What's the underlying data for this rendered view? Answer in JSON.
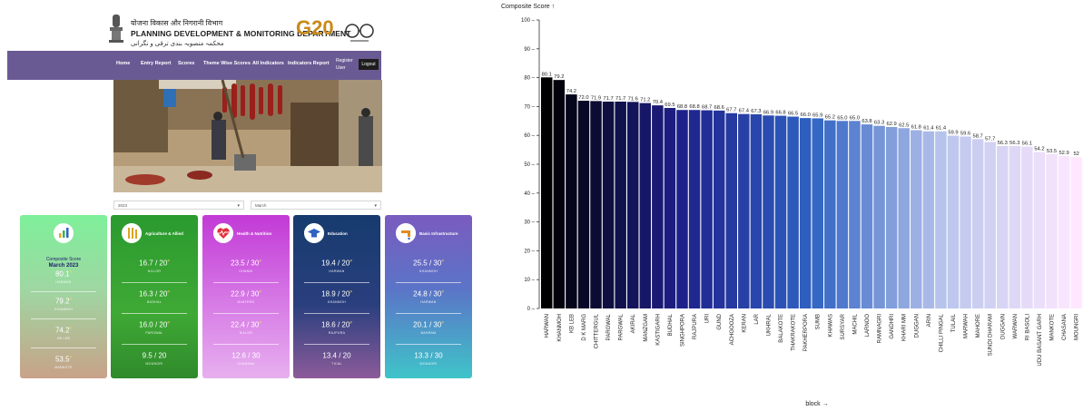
{
  "site": {
    "header": {
      "hindi_title": "योजना विकास और निगरानी विभाग",
      "title": "PLANNING DEVELOPMENT & MONITORING DEPARTMENT",
      "urdu_title": "محکمہ منصوبہ بندی ترقی و نگرانی",
      "g20_logo": "G20"
    },
    "nav": {
      "items": [
        "Home",
        "Entry Report",
        "Scores",
        "Theme Wise Scores",
        "All Indicators",
        "Indicators Report"
      ],
      "register": "Register User",
      "logout": "Logout"
    },
    "filters": {
      "year": "2023",
      "month": "March"
    },
    "cards": [
      {
        "name": "Composite Score",
        "subtitle": "March 2023",
        "icon": "bar-chart-icon",
        "rows": [
          {
            "value": "80.1",
            "sup": "#",
            "label": "HARWAN"
          },
          {
            "value": "79.2",
            "sup": "#",
            "label": "KHANMOH"
          },
          {
            "value": "74.2",
            "sup": "#",
            "label": "KB LEB"
          },
          {
            "value": "53.5",
            "sup": "#",
            "label": "MANKOTE"
          }
        ]
      },
      {
        "name": "Agriculture & Allied",
        "icon": "wheat-icon",
        "rows": [
          {
            "value": "16.7 / 20",
            "sup": "#",
            "label": "NILLOR"
          },
          {
            "value": "16.3 / 20",
            "sup": "#",
            "label": "BUDHAL"
          },
          {
            "value": "16.0 / 20",
            "sup": "#",
            "label": "PARGWAL"
          },
          {
            "value": "9.5 / 20",
            "sup": "",
            "label": "MOUNGRI"
          }
        ]
      },
      {
        "name": "Health & Nutrition",
        "icon": "heart-pulse-icon",
        "rows": [
          {
            "value": "23.5 / 30",
            "sup": "#",
            "label": "CHANDI"
          },
          {
            "value": "22.9 / 30",
            "sup": "#",
            "label": "DHATERO"
          },
          {
            "value": "22.4 / 30",
            "sup": "#",
            "label": "NILLOR"
          },
          {
            "value": "12.6 / 30",
            "sup": "",
            "label": "CHASANA"
          }
        ]
      },
      {
        "name": "Education",
        "icon": "graduation-cap-icon",
        "rows": [
          {
            "value": "19.4 / 20",
            "sup": "#",
            "label": "HARWAN"
          },
          {
            "value": "18.9 / 20",
            "sup": "#",
            "label": "KHANMOH"
          },
          {
            "value": "18.6 / 20",
            "sup": "#",
            "label": "RAJPURA"
          },
          {
            "value": "13.4 / 20",
            "sup": "",
            "label": "TICAL"
          }
        ]
      },
      {
        "name": "Basic Infrastructure",
        "icon": "tap-icon",
        "rows": [
          {
            "value": "25.5 / 30",
            "sup": "#",
            "label": "KHANMOH"
          },
          {
            "value": "24.8 / 30",
            "sup": "#",
            "label": "HARWAN"
          },
          {
            "value": "20.1 / 30",
            "sup": "#",
            "label": "BAHRAM"
          },
          {
            "value": "13.3 / 30",
            "sup": "",
            "label": "MOUNGRI"
          }
        ]
      }
    ]
  },
  "chart_data": {
    "type": "bar",
    "ylabel": "Composite Score ↑",
    "xlabel": "block →",
    "ylim": [
      0,
      100
    ],
    "yticks": [
      0,
      10,
      20,
      30,
      40,
      50,
      60,
      70,
      80,
      90,
      100
    ],
    "grid": false,
    "color_ramp": [
      "#000000",
      "#1f1f8a",
      "#2f62c2",
      "#b9c5ec",
      "#ffe8ff"
    ],
    "categories": [
      "HARWAN",
      "KHANMOH",
      "KB LEB",
      "D K MARG",
      "CHITTERGUL",
      "PARGWAL",
      "PARGWAL",
      "AKIRAL",
      "MANZGAM",
      "KASTIGARH",
      "BUDHAL",
      "SINGHPORA",
      "RAJPURA",
      "URI",
      "GUND",
      "ACHGOOZA",
      "KERAN",
      "LAR",
      "UKHRAL",
      "BALAKOTE",
      "THAKRAKOTE",
      "PAKHERPORA",
      "SUMB",
      "KHAWAS",
      "SURSYAR",
      "MACHIL",
      "LARNOO",
      "RAMNAGRI",
      "GANDHRI",
      "KHARI MM",
      "DUGGAN",
      "ARIN",
      "CHILLI PINGAL",
      "TULAIL",
      "MARWAH",
      "MAHORE",
      "SUNDI DHARAM",
      "DUGGAIN",
      "WARWAN",
      "RI BASOLI",
      "UDU BASANT GARH",
      "MANKOTE",
      "CHASANA",
      "MOUNGRI"
    ],
    "values": [
      80.1,
      79.2,
      74.2,
      72.0,
      71.9,
      71.7,
      71.7,
      71.6,
      71.2,
      70.4,
      69.5,
      68.8,
      68.8,
      68.7,
      68.6,
      67.7,
      67.4,
      67.3,
      66.9,
      66.8,
      66.5,
      66.0,
      65.9,
      65.2,
      65.0,
      65.0,
      63.8,
      63.3,
      62.9,
      62.5,
      61.8,
      61.4,
      61.4,
      59.9,
      59.6,
      58.7,
      57.7,
      56.3,
      56.3,
      56.1,
      54.2,
      53.5,
      52.9,
      52.5
    ],
    "data_labels": [
      "80.1",
      "79.2",
      "74.2",
      "72.0",
      "71.9",
      "71.7",
      "71.7",
      "71.6",
      "71.2",
      "70.4",
      "69.5",
      "68.8",
      "68.8",
      "68.7",
      "68.6",
      "67.7",
      "67.4",
      "67.3",
      "66.9",
      "66.8",
      "66.5",
      "66.0",
      "65.9",
      "65.2",
      "65.0",
      "65.0",
      "63.8",
      "63.3",
      "62.9",
      "62.5",
      "61.8",
      "61.4",
      "61.4",
      "59.9",
      "59.6",
      "58.7",
      "57.7",
      "56.3",
      "56.3",
      "56.1",
      "54.2",
      "53.5",
      "52.9",
      "52"
    ]
  }
}
